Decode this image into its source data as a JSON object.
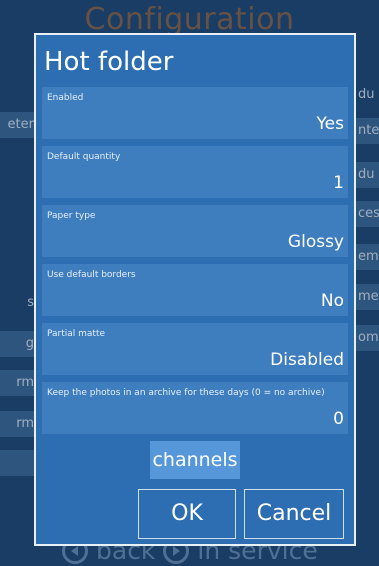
{
  "background": {
    "title": "Configuration",
    "left_items": [
      "eter",
      "s",
      "g",
      "rm",
      "rm"
    ],
    "right_items": [
      "du",
      "nte",
      "du",
      "ces",
      "em",
      "me",
      "om"
    ],
    "bottom_nav": [
      {
        "label": "back",
        "icon": "back-arrow-icon"
      },
      {
        "label": "in service",
        "icon": "play-icon"
      }
    ]
  },
  "dialog": {
    "title": "Hot folder",
    "fields": [
      {
        "label": "Enabled",
        "value": "Yes"
      },
      {
        "label": "Default quantity",
        "value": "1"
      },
      {
        "label": "Paper type",
        "value": "Glossy"
      },
      {
        "label": "Use default borders",
        "value": "No"
      },
      {
        "label": "Partial matte",
        "value": "Disabled"
      },
      {
        "label": "Keep the photos in an archive for these days (0 = no archive)",
        "value": "0"
      }
    ],
    "channels_label": "channels",
    "ok_label": "OK",
    "cancel_label": "Cancel"
  },
  "colors": {
    "background": "#1e4a78",
    "dialog": "#2d6db1",
    "field": "#3e7ebf",
    "accent_button": "#5597d8",
    "title_orange": "#d97a2a"
  }
}
